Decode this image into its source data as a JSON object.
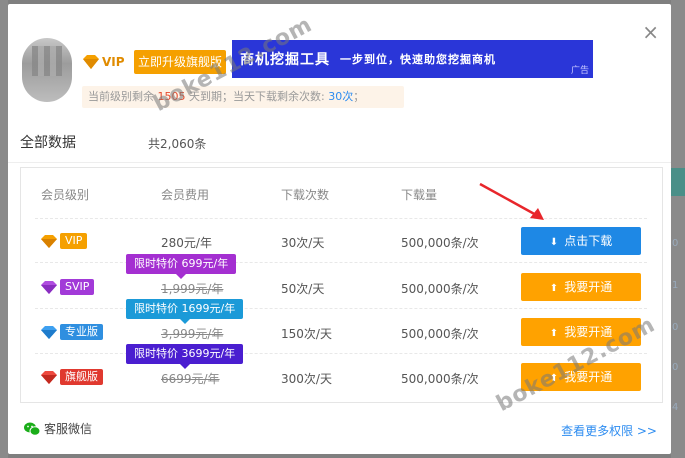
{
  "background": {
    "right_numbers": [
      "0",
      "1",
      "0",
      "0",
      "4"
    ]
  },
  "header": {
    "vip_label": "VIP",
    "upgrade_label": "立即升级旗舰版",
    "ad": {
      "main": "商机挖掘工具",
      "sub": "一步到位，快速助您挖掘商机",
      "tag": "广告"
    },
    "quota": {
      "prefix": "当前级别剩余",
      "days": "1505",
      "mid": "天到期；当天下载剩余次数:",
      "count": "30次",
      "suffix": "；"
    }
  },
  "section": {
    "title": "全部数据",
    "count": "共2,060条"
  },
  "table": {
    "headers": [
      "会员级别",
      "会员费用",
      "下载次数",
      "下载量"
    ],
    "rows": [
      {
        "tier": "VIP",
        "tier_color": "#f5a000",
        "price": "280元/年",
        "strike": false,
        "downloads": "30次/天",
        "volume": "500,000条/次",
        "action": "点击下载",
        "action_icon": "download-icon",
        "action_style": "blue",
        "promo": ""
      },
      {
        "tier": "SVIP",
        "tier_color": "#a23ad8",
        "price": "1,999元/年",
        "strike": true,
        "downloads": "50次/天",
        "volume": "500,000条/次",
        "action": "我要开通",
        "action_icon": "arrow-up-icon",
        "action_style": "orange",
        "promo": "限时特价 699元/年",
        "promo_color": "#a42fd1"
      },
      {
        "tier": "专业版",
        "tier_color": "#2f8fe0",
        "price": "3,999元/年",
        "strike": true,
        "downloads": "150次/天",
        "volume": "500,000条/次",
        "action": "我要开通",
        "action_icon": "arrow-up-icon",
        "action_style": "orange",
        "promo": "限时特价 1699元/年",
        "promo_color": "#1b9ad8"
      },
      {
        "tier": "旗舰版",
        "tier_color": "#e0392f",
        "price": "6699元/年",
        "strike": true,
        "downloads": "300次/天",
        "volume": "500,000条/次",
        "action": "我要开通",
        "action_icon": "arrow-up-icon",
        "action_style": "orange",
        "promo": "限时特价 3699元/年",
        "promo_color": "#4a1ed0"
      }
    ]
  },
  "footer": {
    "wechat_label": "客服微信",
    "more_label": "查看更多权限 >>"
  },
  "watermarks": [
    "boke112.com",
    "boke112.com"
  ],
  "colors": {
    "primary_blue": "#1e88e5",
    "primary_orange": "#ffa200",
    "ad_blue": "#2a36d8",
    "link_blue": "#2d8cf0"
  }
}
